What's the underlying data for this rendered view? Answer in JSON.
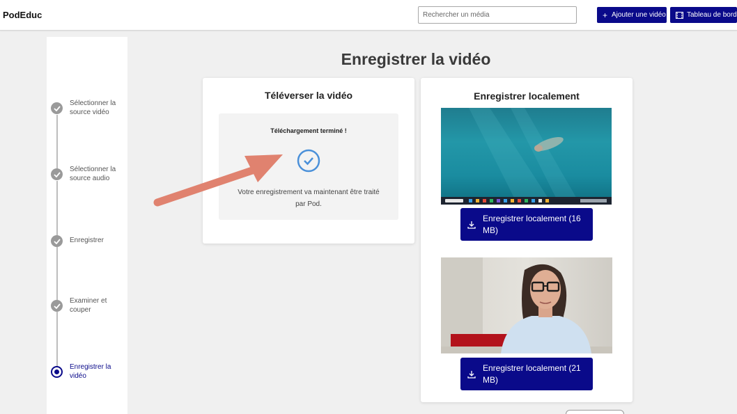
{
  "header": {
    "brand": "PodEduc",
    "search_placeholder": "Rechercher un média",
    "add_video_label": "Ajouter une vidéo",
    "dashboard_label": "Tableau de bord"
  },
  "stepper": {
    "steps": [
      {
        "label": "Sélectionner la source vidéo",
        "state": "done"
      },
      {
        "label": "Sélectionner la source audio",
        "state": "done"
      },
      {
        "label": "Enregistrer",
        "state": "done"
      },
      {
        "label": "Examiner et couper",
        "state": "done"
      },
      {
        "label": "Enregistrer la vidéo",
        "state": "active"
      }
    ]
  },
  "main": {
    "title": "Enregistrer la vidéo",
    "upload_card": {
      "title": "Téléverser la vidéo",
      "status": "Téléchargement terminé !",
      "message": "Votre enregistrement va maintenant être traité par Pod."
    },
    "local_card": {
      "title": "Enregistrer localement",
      "downloads": [
        {
          "label": "Enregistrer localement (16 MB)",
          "thumbnail": "screen-recording"
        },
        {
          "label": "Enregistrer localement (21 MB)",
          "thumbnail": "camera-recording"
        }
      ]
    }
  },
  "colors": {
    "accent": "#0a0a8a",
    "step_done": "#9a9a9a",
    "check": "#4a90d9",
    "annotation_arrow": "#e0826f"
  }
}
